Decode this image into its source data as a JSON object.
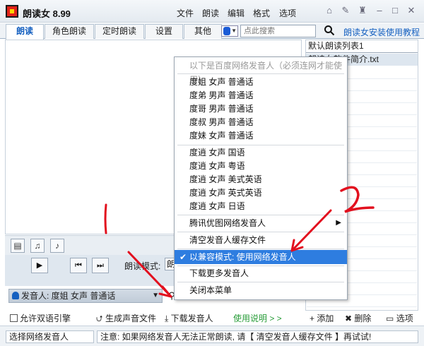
{
  "app": {
    "title": "朗读女 8.99"
  },
  "menu": [
    "文件",
    "朗读",
    "编辑",
    "格式",
    "选项"
  ],
  "tabs": [
    {
      "label": "朗读",
      "active": true
    },
    {
      "label": "角色朗读",
      "active": false
    },
    {
      "label": "定时朗读",
      "active": false
    },
    {
      "label": "设置",
      "active": false
    },
    {
      "label": "其他",
      "active": false
    }
  ],
  "search": {
    "placeholder": "点此搜索",
    "icon": "search-icon"
  },
  "tutorial_link": "朗读女安装使用教程",
  "playlist": {
    "selected": "默认朗读列表1",
    "items": [
      "朗读女软件简介.txt"
    ],
    "add_label": "添加",
    "delete_label": "删除",
    "options_label": "选项"
  },
  "player": {
    "mode_label": "朗读模式:",
    "mode_value": "朗"
  },
  "speaker": {
    "label": "发音人: 度姐 女声 普通话"
  },
  "bottom": {
    "bilingual_label": "允许双语引擎",
    "generate_label": "生成声音文件",
    "download_label": "下载发音人",
    "instructions_link": "使用说明 > >"
  },
  "status": {
    "left": "选择网络发音人",
    "message": "注意: 如果网络发音人无法正常朗读, 请【 清空发音人缓存文件 】再试试!"
  },
  "popup": {
    "header": "以下是百度网络发音人（必须连网才能使用）",
    "voices_a": [
      "度姐 女声 普通话",
      "度弟 男声 普通话",
      "度哥 男声 普通话",
      "度叔 男声 普通话",
      "度妹 女声 普通话"
    ],
    "voices_b": [
      "度逍 女声 国语",
      "度逍 女声 粤语",
      "度逍 女声 美式英语",
      "度逍 女声 英式英语",
      "度逍 女声 日语"
    ],
    "tencent": "腾讯优图网络发音人",
    "clear_cache": "清空发音人缓存文件",
    "compat_mode": "以兼容模式: 使用网络发音人",
    "download_more": "下载更多发音人",
    "close": "关闭本菜单"
  },
  "annotations": {
    "num1": "1",
    "num2": "2"
  },
  "colors": {
    "accent": "#1560c0",
    "selection": "#2e7de0",
    "annotation": "#e2101e",
    "link_green": "#2a9d3a"
  }
}
